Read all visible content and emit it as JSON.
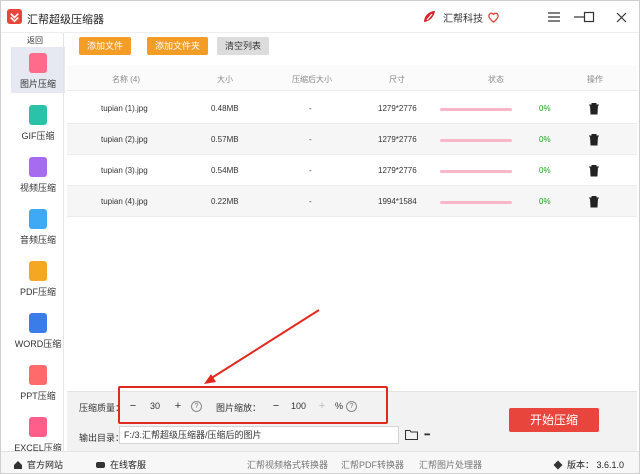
{
  "app": {
    "title": "汇帮超级压缩器"
  },
  "brand": {
    "name": "汇帮科技"
  },
  "sidebar": {
    "back_label": "返回",
    "items": [
      {
        "label": "图片压缩",
        "color": "#ff6b8a"
      },
      {
        "label": "GIF压缩",
        "color": "#2bc3a8"
      },
      {
        "label": "视频压缩",
        "color": "#a66bf0"
      },
      {
        "label": "音频压缩",
        "color": "#3fa9f5"
      },
      {
        "label": "PDF压缩",
        "color": "#f5a623"
      },
      {
        "label": "WORD压缩",
        "color": "#3b7de8"
      },
      {
        "label": "PPT压缩",
        "color": "#ff6b6b"
      },
      {
        "label": "EXCEL压缩",
        "color": "#ff5e8a"
      }
    ]
  },
  "toolbar": {
    "add_file": "添加文件",
    "add_folder": "添加文件夹",
    "clear_list": "清空列表"
  },
  "table": {
    "headers": [
      "名称 (4)",
      "大小",
      "压缩后大小",
      "尺寸",
      "状态",
      "操作"
    ],
    "rows": [
      {
        "name": "tupian (1).jpg",
        "size": "0.48MB",
        "compressed": "-",
        "dims": "1279*2776",
        "progress": 0,
        "pct": "0%"
      },
      {
        "name": "tupian (2).jpg",
        "size": "0.57MB",
        "compressed": "-",
        "dims": "1279*2776",
        "progress": 0,
        "pct": "0%"
      },
      {
        "name": "tupian (3).jpg",
        "size": "0.54MB",
        "compressed": "-",
        "dims": "1279*2776",
        "progress": 0,
        "pct": "0%"
      },
      {
        "name": "tupian (4).jpg",
        "size": "0.22MB",
        "compressed": "-",
        "dims": "1994*1584",
        "progress": 0,
        "pct": "0%"
      }
    ]
  },
  "settings": {
    "quality_label": "压缩质量：",
    "quality_value": "30",
    "scale_label": "图片缩放：",
    "scale_value": "100",
    "scale_unit": "%",
    "minus": "−",
    "plus": "+",
    "help": "?",
    "output_label": "输出目录：",
    "output_path": "F:/3.汇帮超级压缩器/压缩后的图片",
    "more": "•••",
    "start_label": "开始压缩"
  },
  "footer": {
    "official_site": "官方网站",
    "online_service": "在线客服",
    "link1": "汇帮视频格式转换器",
    "link2": "汇帮PDF转换器",
    "link3": "汇帮图片处理器",
    "version": "版本：  3.6.1.0"
  },
  "colors": {
    "accent_orange": "#f39c26",
    "start_red": "#e8453c",
    "annotation_red": "#e12a1f",
    "progress_pink": "#f7b7c9",
    "percent_green": "#19a319"
  }
}
